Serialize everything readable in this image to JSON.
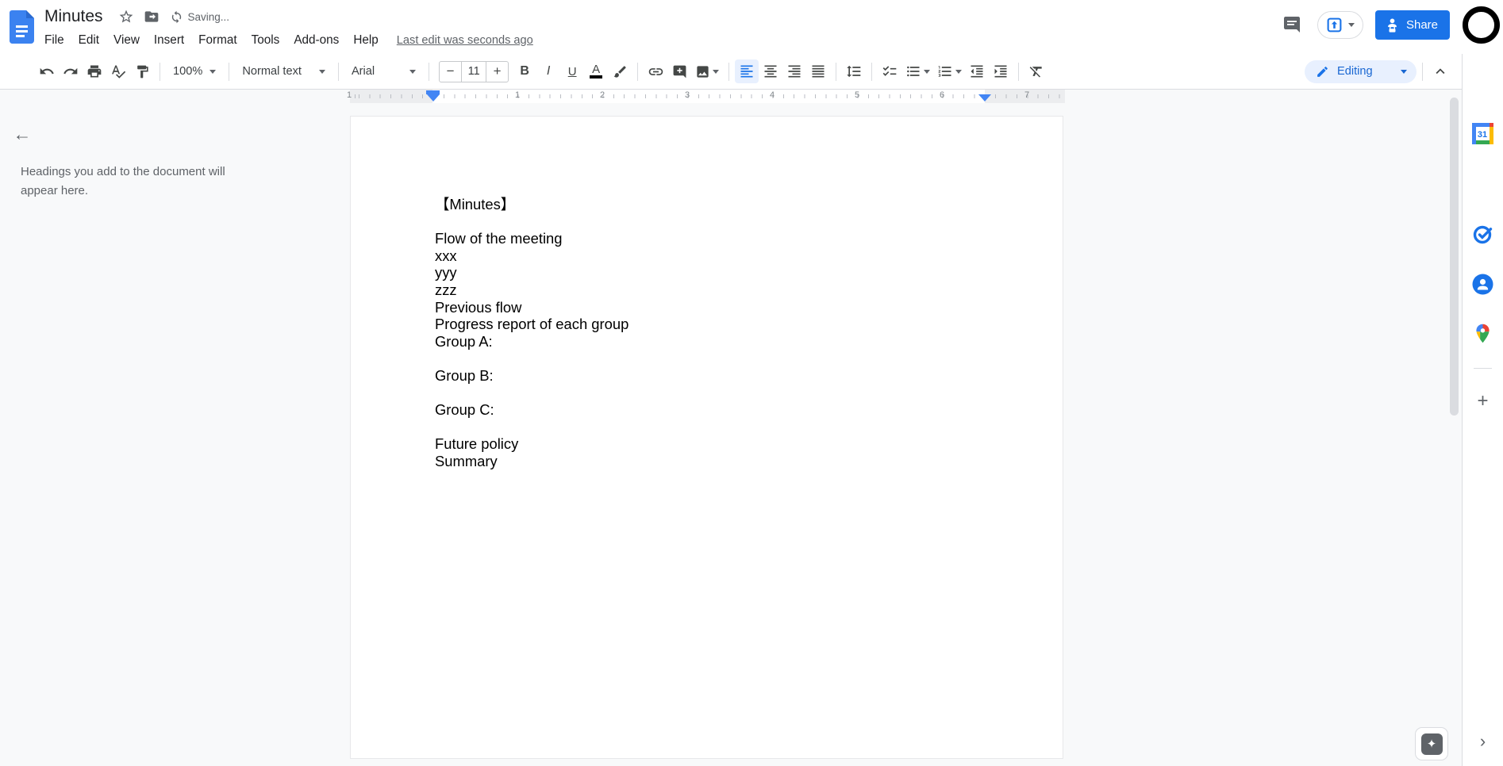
{
  "header": {
    "title": "Minutes",
    "saving": "Saving...",
    "menu": [
      "File",
      "Edit",
      "View",
      "Insert",
      "Format",
      "Tools",
      "Add-ons",
      "Help"
    ],
    "last_edit": "Last edit was seconds ago",
    "share": "Share",
    "mode": "Editing"
  },
  "toolbar": {
    "zoom": "100%",
    "styles": "Normal text",
    "font": "Arial",
    "font_size": "11",
    "minus": "−",
    "plus": "+",
    "bold": "B",
    "italic": "I",
    "underline": "U",
    "text_color": "A"
  },
  "ruler": {
    "numbers": [
      "1",
      "1",
      "2",
      "3",
      "4",
      "5",
      "6",
      "7"
    ]
  },
  "outline": {
    "back": "←",
    "placeholder": "Headings you add to the document will appear here."
  },
  "document": {
    "lines": [
      "【Minutes】",
      "",
      "Flow of the meeting",
      "xxx",
      "yyy",
      "zzz",
      "Previous flow",
      "Progress report of each group",
      "Group A:",
      "",
      "Group B:",
      "",
      "Group C:",
      "",
      "Future policy",
      "Summary"
    ]
  },
  "rail": {
    "calendar_day": "31",
    "add": "+",
    "collapse": "›"
  },
  "explore": {
    "glyph": "✦"
  },
  "colors": {
    "accent": "#1a73e8",
    "active_bg": "#e8f0fe",
    "marker": "#4285f4"
  }
}
